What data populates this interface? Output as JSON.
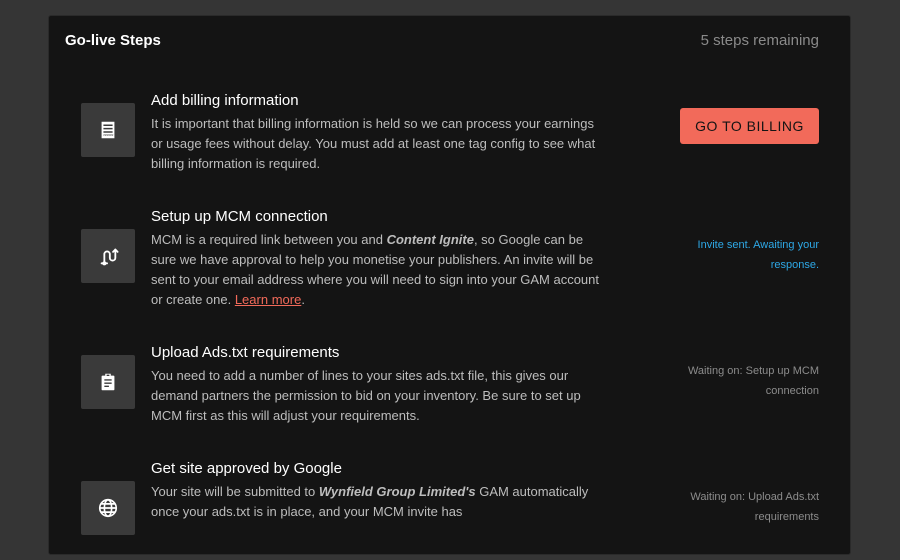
{
  "header": {
    "title": "Go-live Steps",
    "remaining": "5 steps remaining"
  },
  "steps": [
    {
      "icon": "receipt-icon",
      "title": "Add billing information",
      "desc": "It is important that billing information is held so we can process your earnings or usage fees without delay. You must add at least one tag config to see what billing information is required.",
      "action_label": "GO TO BILLING"
    },
    {
      "icon": "connection-icon",
      "title": "Setup up MCM connection",
      "desc_a": "MCM is a required link between you and ",
      "desc_em": "Content Ignite",
      "desc_b": ", so Google can be sure we have approval to help you monetise your publishers. An invite will be sent to your email address where you will need to sign into your GAM account or create one. ",
      "link": "Learn more",
      "desc_c": ".",
      "status": "Invite sent. Awaiting your response."
    },
    {
      "icon": "clipboard-icon",
      "title": "Upload Ads.txt requirements",
      "desc": "You need to add a number of lines to your sites ads.txt file, this gives our demand partners the permission to bid on your inventory. Be sure to set up MCM first as this will adjust your requirements.",
      "status": "Waiting on: Setup up MCM connection"
    },
    {
      "icon": "globe-icon",
      "title": "Get site approved by Google",
      "desc_a": "Your site will be submitted to ",
      "desc_em": "Wynfield Group Limited's",
      "desc_b": " GAM automatically once your ads.txt is in place, and your MCM invite has",
      "status": "Waiting on: Upload Ads.txt requirements"
    }
  ],
  "colors": {
    "accent": "#f26a5a",
    "status_blue": "#2ea8e6",
    "status_grey": "#8c8c8c"
  }
}
